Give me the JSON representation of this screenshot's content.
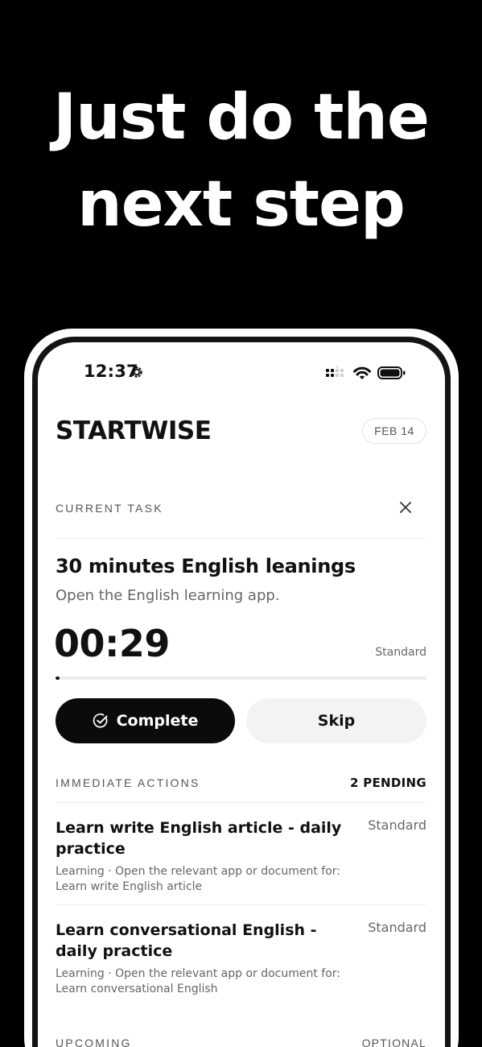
{
  "headline": {
    "line1": "Just do the",
    "line2": "next step"
  },
  "status_bar": {
    "time": "12:37"
  },
  "app": {
    "brand": "STARTWISE",
    "date": "FEB 14"
  },
  "current_task": {
    "label": "CURRENT TASK",
    "title": "30 minutes English leanings",
    "subtitle": "Open the English learning app.",
    "timer": "00:29",
    "mode": "Standard",
    "progress_fraction": 0.01,
    "complete_label": "Complete",
    "skip_label": "Skip"
  },
  "immediate_actions": {
    "label": "IMMEDIATE ACTIONS",
    "count": "2 PENDING",
    "items": [
      {
        "title": "Learn write English article - daily practice",
        "description": "Learning · Open the relevant app or document for: Learn write English article",
        "tag": "Standard"
      },
      {
        "title": "Learn conversational English - daily practice",
        "description": "Learning · Open the relevant app or document for: Learn conversational English",
        "tag": "Standard"
      }
    ]
  },
  "upcoming": {
    "label": "UPCOMING",
    "tag": "OPTIONAL"
  }
}
